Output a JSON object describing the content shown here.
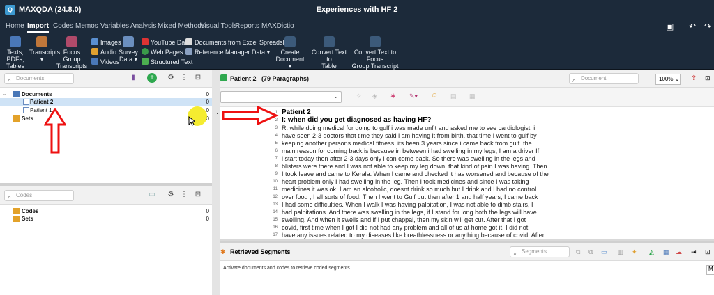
{
  "titlebar": {
    "app": "MAXQDA (24.8.0)",
    "document_title": "Experiences with HF 2"
  },
  "menu": {
    "tabs": [
      "Home",
      "Import",
      "Codes",
      "Memos",
      "Variables",
      "Analysis",
      "Mixed Methods",
      "Visual Tools",
      "Reports",
      "MAXDictio"
    ],
    "active": "Import"
  },
  "ribbon": {
    "texts_pdfs": "Texts, PDFs,",
    "tables": "Tables",
    "transcripts": "Transcripts",
    "focus_group": "Focus Group",
    "focus_group2": "Transcripts",
    "images": "Images",
    "audio": "Audio",
    "videos": "Videos",
    "survey": "Survey",
    "survey2": "Data",
    "youtube": "YouTube Data",
    "web_pages": "Web Pages",
    "structured": "Structured Text",
    "excel": "Documents from Excel Spreadsheet",
    "reference": "Reference Manager Data",
    "create_doc": "Create",
    "create_doc2": "Document",
    "convert_table": "Convert Text to",
    "convert_table2": "Table Document",
    "convert_focus": "Convert Text to Focus",
    "convert_focus2": "Group Transcript"
  },
  "documents_pane": {
    "search_placeholder": "Documents",
    "tree": [
      {
        "label": "Documents",
        "count": "0"
      },
      {
        "label": "Patient 2",
        "count": "0"
      },
      {
        "label": "Patient 1",
        "count": "0"
      },
      {
        "label": "Sets",
        "count": "0"
      }
    ]
  },
  "codes_pane": {
    "search_placeholder": "Codes",
    "tree": [
      {
        "label": "Codes",
        "count": "0"
      },
      {
        "label": "Sets",
        "count": "0"
      }
    ]
  },
  "document_browser": {
    "title": "Patient 2",
    "paragraphs": "(79 Paragraphs)",
    "search_placeholder": "Document",
    "zoom": "100%",
    "lines": [
      {
        "n": "1",
        "t": "Patient 2",
        "bold": true
      },
      {
        "n": "2",
        "t": "I: when did you get diagnosed as having HF?",
        "bold": true
      },
      {
        "n": "3",
        "t": "R: while doing medical for going to gulf i was made unfit and asked me to see cardiologist. i"
      },
      {
        "n": "4",
        "t": "have seen 2-3 doctors that time they said i am having it from birth. that time I went to gulf by"
      },
      {
        "n": "5",
        "t": "keeping another person\u0019s medical fitness. it\u0019s been 3 years since i came back from gulf. the"
      },
      {
        "n": "6",
        "t": "main reason for coming back is because in between i had swelling in my legs, I am a driver If"
      },
      {
        "n": "7",
        "t": "i start today then after 2-3 days only i can come back. So there was swelling in the legs and"
      },
      {
        "n": "8",
        "t": "blisters were there and I was not able to keep my leg down, that kind of pain I was having. Then"
      },
      {
        "n": "9",
        "t": "I took leave and came to Kerala. When I came and checked it has worsened and because of the"
      },
      {
        "n": "10",
        "t": "heart problem only I had swelling in the leg. Then I took medicines and since I was taking"
      },
      {
        "n": "11",
        "t": "medicines it was ok. I am an alcoholic, doesn\u0019t drink so much but I drink and I had no control"
      },
      {
        "n": "12",
        "t": "over food , I all sorts of food. Then I went to Gulf but then after 1 and half years, I came back"
      },
      {
        "n": "13",
        "t": "I had some difficulties. When I walk I was having palpitation, I was not able to dimb stairs, I"
      },
      {
        "n": "14",
        "t": "had palpitations. And there was swelling in the legs, if I stand for long both the legs will have"
      },
      {
        "n": "15",
        "t": "swelling. And when it swells and if I put chappal, then my skin will get cut. After that I got"
      },
      {
        "n": "16",
        "t": "covid, first time when I got I did not had any problem and all of us at home got it. I did not"
      },
      {
        "n": "17",
        "t": "have any issues related to my diseases like breathlessness or anything because of covid. After"
      }
    ]
  },
  "retrieved_segments": {
    "title": "Retrieved Segments",
    "search_placeholder": "Segments",
    "message": "Activate documents and codes to retrieve coded segments ..."
  }
}
